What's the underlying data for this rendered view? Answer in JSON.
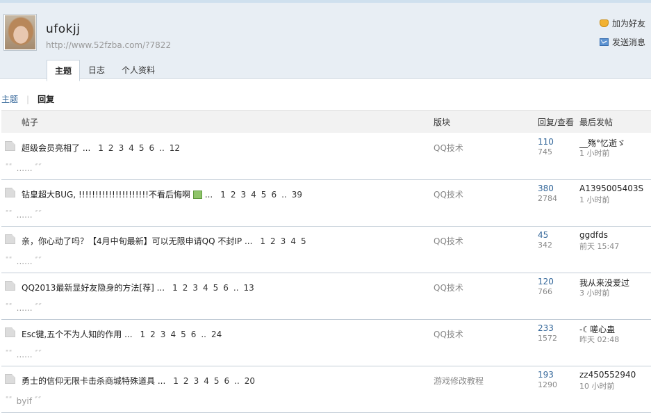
{
  "profile": {
    "username": "ufokjj",
    "url": "http://www.52fzba.com/?7822",
    "actions": [
      {
        "label": "加为好友",
        "icon": "add-friend-icon"
      },
      {
        "label": "发送消息",
        "icon": "mail-icon"
      }
    ],
    "tabs": [
      {
        "label": "主题",
        "active": true
      },
      {
        "label": "日志",
        "active": false
      },
      {
        "label": "个人资料",
        "active": false
      }
    ]
  },
  "subnav": {
    "topics": "主题",
    "replies": "回复"
  },
  "table": {
    "headers": {
      "post": "帖子",
      "forum": "版块",
      "stats": "回复/查看",
      "last": "最后发帖"
    },
    "rows": [
      {
        "title": "超级会员亮相了",
        "pages": [
          "1",
          "2",
          "3",
          "4",
          "5",
          "6"
        ],
        "last_page": "12",
        "has_image": false,
        "forum": "QQ技术",
        "replies": "110",
        "views": "745",
        "last_user": "__殇°忆逝ゞ",
        "last_time": "1 小时前",
        "quote": "......"
      },
      {
        "title": "钻皇超大BUG, !!!!!!!!!!!!!!!!!!!!!不看后悔啊",
        "pages": [
          "1",
          "2",
          "3",
          "4",
          "5",
          "6"
        ],
        "last_page": "39",
        "has_image": true,
        "forum": "QQ技术",
        "replies": "380",
        "views": "2784",
        "last_user": "A1395005403S",
        "last_time": "1 小时前",
        "quote": "......"
      },
      {
        "title": "亲，你心动了吗？【4月中旬最新】可以无限申请QQ 不封IP",
        "pages": [
          "1",
          "2",
          "3",
          "4",
          "5"
        ],
        "last_page": "",
        "has_image": false,
        "forum": "QQ技术",
        "replies": "45",
        "views": "342",
        "last_user": "ggdfds",
        "last_time": "前天 15:47",
        "quote": "......"
      },
      {
        "title": "QQ2013最新显好友隐身的方法[荐]",
        "pages": [
          "1",
          "2",
          "3",
          "4",
          "5",
          "6"
        ],
        "last_page": "13",
        "has_image": false,
        "forum": "QQ技术",
        "replies": "120",
        "views": "766",
        "last_user": "我从来没爱过",
        "last_time": "3 小时前",
        "quote": "......"
      },
      {
        "title": "Esc键,五个不为人知的作用",
        "pages": [
          "1",
          "2",
          "3",
          "4",
          "5",
          "6"
        ],
        "last_page": "24",
        "has_image": false,
        "forum": "QQ技术",
        "replies": "233",
        "views": "1572",
        "last_user": "-☾嗟心蛊",
        "last_time": "昨天 02:48",
        "quote": "......"
      },
      {
        "title": "勇士的信仰无限卡击杀商城特殊道具",
        "pages": [
          "1",
          "2",
          "3",
          "4",
          "5",
          "6"
        ],
        "last_page": "20",
        "has_image": false,
        "forum": "游戏修改教程",
        "replies": "193",
        "views": "1290",
        "last_user": "zz450552940",
        "last_time": "10 小时前",
        "quote": "byif"
      }
    ]
  }
}
